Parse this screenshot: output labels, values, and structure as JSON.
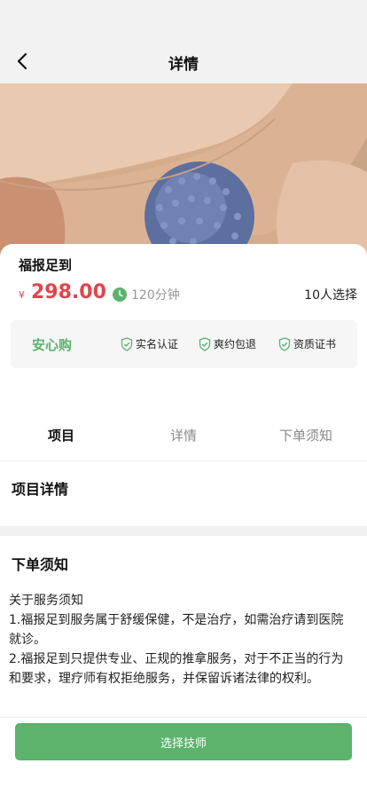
{
  "header": {
    "title": "详情",
    "back_icon": "chevron-left-icon"
  },
  "hero": {
    "image": "foot-massage-ball-photo"
  },
  "product": {
    "name": "福报足到",
    "currency_symbol": "¥",
    "price": "298.00",
    "duration": "120分钟",
    "chosen_count": "10人选择"
  },
  "trust": {
    "main_label": "安心购",
    "badges": [
      {
        "label": "实名认证",
        "icon": "shield-check-icon"
      },
      {
        "label": "爽约包退",
        "icon": "shield-check-icon"
      },
      {
        "label": "资质证书",
        "icon": "shield-check-icon"
      }
    ]
  },
  "tabs": [
    {
      "label": "项目",
      "active": true
    },
    {
      "label": "详情",
      "active": false
    },
    {
      "label": "下单须知",
      "active": false
    }
  ],
  "sections": {
    "project_details_title": "项目详情",
    "order_notice_title": "下单须知"
  },
  "notice_lines": [
    "关于服务须知",
    "1.福报足到服务属于舒缓保健，不是治疗，如需治疗请到医院",
    "就诊。",
    "2.福报足到只提供专业、正规的推拿服务，对于不正当的行为 和要求，理疗师有权拒绝服务，并保留诉诸法律的权利。"
  ],
  "bottom": {
    "cta_label": "选择技师"
  },
  "colors": {
    "accent_green": "#5bb36c",
    "price_red": "#e0454b",
    "nav_bg": "#f2f2f2"
  }
}
